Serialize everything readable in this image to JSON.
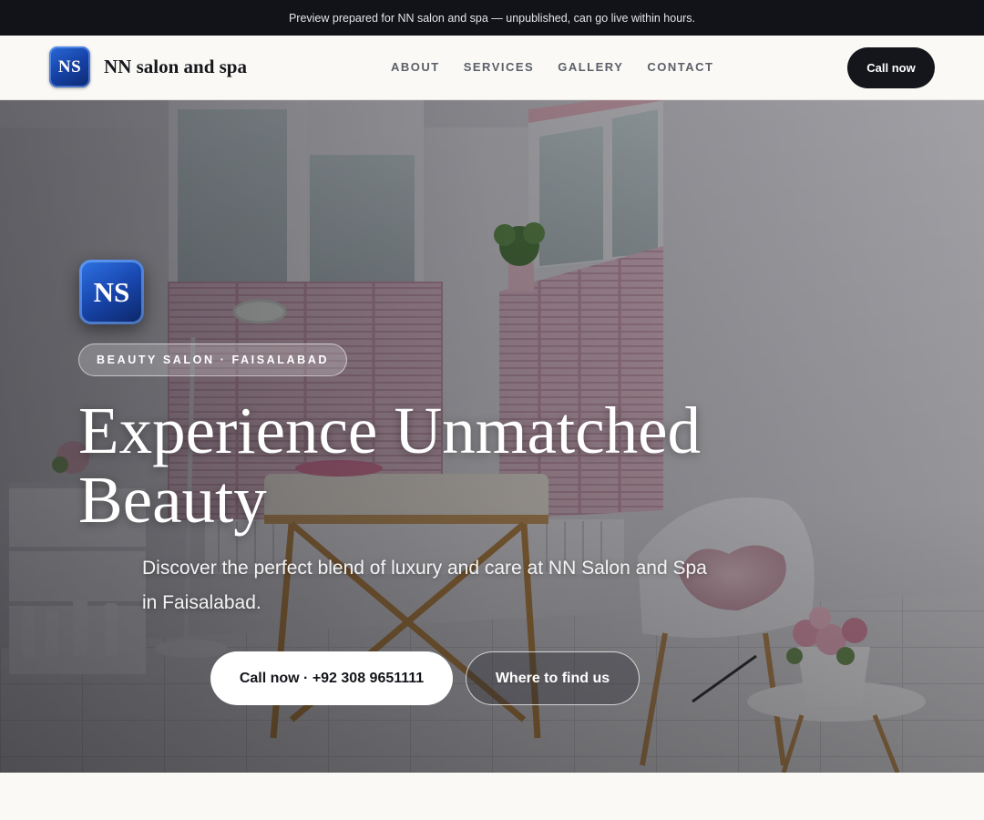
{
  "preview_bar": {
    "text": "Preview prepared for NN salon and spa — unpublished, can go live within hours."
  },
  "header": {
    "logo_text": "NS",
    "brand_name": "NN salon and spa",
    "nav": [
      {
        "label": "ABOUT"
      },
      {
        "label": "SERVICES"
      },
      {
        "label": "GALLERY"
      },
      {
        "label": "CONTACT"
      }
    ],
    "call_label": "Call now"
  },
  "hero": {
    "logo_text": "NS",
    "eyebrow": "BEAUTY SALON · FAISALABAD",
    "title": "Experience Unmatched Beauty",
    "subtitle": "Discover the perfect blend of luxury and care at NN Salon and Spa in Faisalabad.",
    "primary_cta": "Call now · +92 308 9651111",
    "secondary_cta": "Where to find us"
  },
  "colors": {
    "dark": "#111318",
    "page_bg": "#faf9f6",
    "logo_blue": "#1846ad",
    "accent_pink": "#d9b3c2"
  }
}
